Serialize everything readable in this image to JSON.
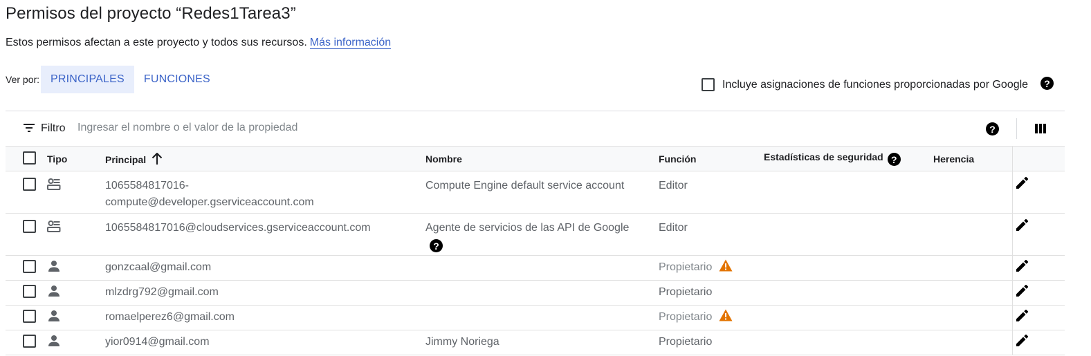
{
  "header": {
    "title": "Permisos del proyecto “Redes1Tarea3”",
    "subtitle": "Estos permisos afectan a este proyecto y todos sus recursos.",
    "more_info_link": "Más información"
  },
  "view_by": {
    "label": "Ver por:",
    "tabs": [
      {
        "label": "PRINCIPALES",
        "active": true
      },
      {
        "label": "FUNCIONES",
        "active": false
      }
    ]
  },
  "google_grants": {
    "label": "Incluye asignaciones de funciones proporcionadas por Google",
    "checked": false
  },
  "filter": {
    "label": "Filtro",
    "placeholder": "Ingresar el nombre o el valor de la propiedad"
  },
  "table": {
    "columns": {
      "type": "Tipo",
      "principal": "Principal",
      "name": "Nombre",
      "role": "Función",
      "security": "Estadísticas de seguridad",
      "inheritance": "Herencia"
    },
    "sort": {
      "column": "principal",
      "direction": "ascending"
    },
    "rows": [
      {
        "type_icon": "service-account-icon",
        "principal": "1065584817016-\ncompute@developer.gserviceaccount.com",
        "name": "Compute Engine default service account",
        "role": "Editor",
        "warning": false
      },
      {
        "type_icon": "service-account-icon",
        "principal": "1065584817016@cloudservices.gserviceaccount.com",
        "name": "Agente de servicios de las API de Google",
        "role": "Editor",
        "warning": false
      },
      {
        "type_icon": "person-icon",
        "principal": "gonzcaal@gmail.com",
        "name": "",
        "role": "Propietario",
        "warning": true
      },
      {
        "type_icon": "person-icon",
        "principal": "mlzdrg792@gmail.com",
        "name": "",
        "role": "Propietario",
        "warning": false
      },
      {
        "type_icon": "person-icon",
        "principal": "romaelperez6@gmail.com",
        "name": "",
        "role": "Propietario",
        "warning": true
      },
      {
        "type_icon": "person-icon",
        "principal": "yior0914@gmail.com",
        "name": "Jimmy Noriega",
        "role": "Propietario",
        "warning": false
      }
    ]
  },
  "icons": {
    "help": "help-circle-icon",
    "warning": "warning-icon",
    "edit": "pencil-edit-icon",
    "columns": "column-display-icon",
    "filter": "filter-list-icon",
    "sort": "arrow-up-icon"
  },
  "colors": {
    "link": "#3c64c8",
    "active_tab_bg": "#e8eefc",
    "warning": "#e37400",
    "header_bg": "#f8f9fa"
  }
}
